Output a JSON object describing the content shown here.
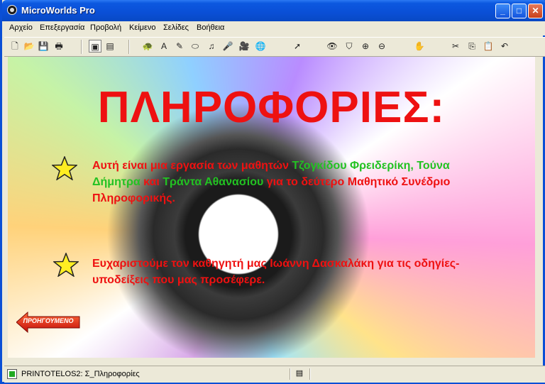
{
  "window": {
    "title": "MicroWorlds Pro"
  },
  "titlebar": {
    "minimize_glyph": "_",
    "maximize_glyph": "□",
    "close_glyph": "✕"
  },
  "menu": [
    "Αρχείο",
    "Επεξεργασία",
    "Προβολή",
    "Κείμενο",
    "Σελίδες",
    "Βοήθεια"
  ],
  "toolbar": {
    "icons": [
      "new-page-icon",
      "open-icon",
      "save-icon",
      "print-icon",
      "shape-center-icon",
      "text-box-tool-icon",
      "turtle-icon",
      "text-icon",
      "paint-icon",
      "button-icon",
      "music-icon",
      "sound-icon",
      "video-icon",
      "network-icon",
      "pointer-icon",
      "eye-icon",
      "stamp-icon",
      "zoom-in-icon",
      "zoom-out-icon",
      "stop-hand-icon",
      "scissors-icon",
      "copy-icon",
      "paste-icon",
      "undo-icon"
    ]
  },
  "page": {
    "title": "ΠΛΗΡΟΦΟΡΙΕΣ:",
    "para1": {
      "t1": "Αυτή είναι μια εργασία των μαθητών ",
      "n1": "Τζογκίδου Φρειδερίκη, Τούνα Δήμητρα",
      "t2": " και ",
      "n2": "Τράντα Αθανασίου",
      "t3": " για το δεύτερο Μαθητικό Συνέδριο Πληροφορικής."
    },
    "para2": "Ευχαριστούμε τον καθηγητή μας Ιωάννη Δασκαλάκη για τις οδηγίες-υποδείξεις που μας προσέφερε.",
    "back_button": "ΠΡΟΗΓΟΥΜΕΝΟ"
  },
  "status": {
    "text": "PRINTOTELOS2: Σ_Πληροφορίες"
  },
  "colors": {
    "title_red": "#ee1111",
    "name_green": "#22c222",
    "titlebar_blue": "#0a4fd6"
  }
}
